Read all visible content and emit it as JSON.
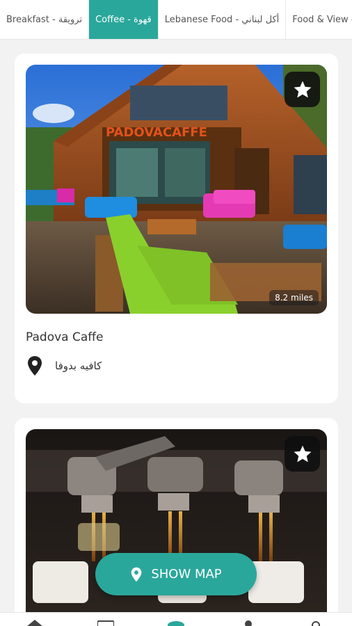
{
  "tabs": [
    {
      "label": "Breakfast - ترويقة",
      "active": false
    },
    {
      "label": "Coffee - قهوة",
      "active": true
    },
    {
      "label": "Lebanese Food - أكل لبناني",
      "active": false
    },
    {
      "label": "Food & View - أكل",
      "active": false
    }
  ],
  "places": [
    {
      "name": "Padova Caffe",
      "location": "كافيه بدوفا",
      "distance": "8.2 miles",
      "sign": "PADOVACAFFE",
      "favorite_icon": "star-icon",
      "location_icon": "map-pin-icon"
    },
    {
      "name": "",
      "favorite_icon": "star-icon"
    }
  ],
  "show_map": {
    "label": "SHOW MAP",
    "icon": "map-pin-icon"
  },
  "colors": {
    "accent": "#2aa79b",
    "fav_bg": "#111111",
    "background": "#f2f2f2"
  },
  "bottom_nav": [
    "home-icon",
    "card-icon",
    "active-tab-icon",
    "profile-icon",
    "settings-icon"
  ]
}
